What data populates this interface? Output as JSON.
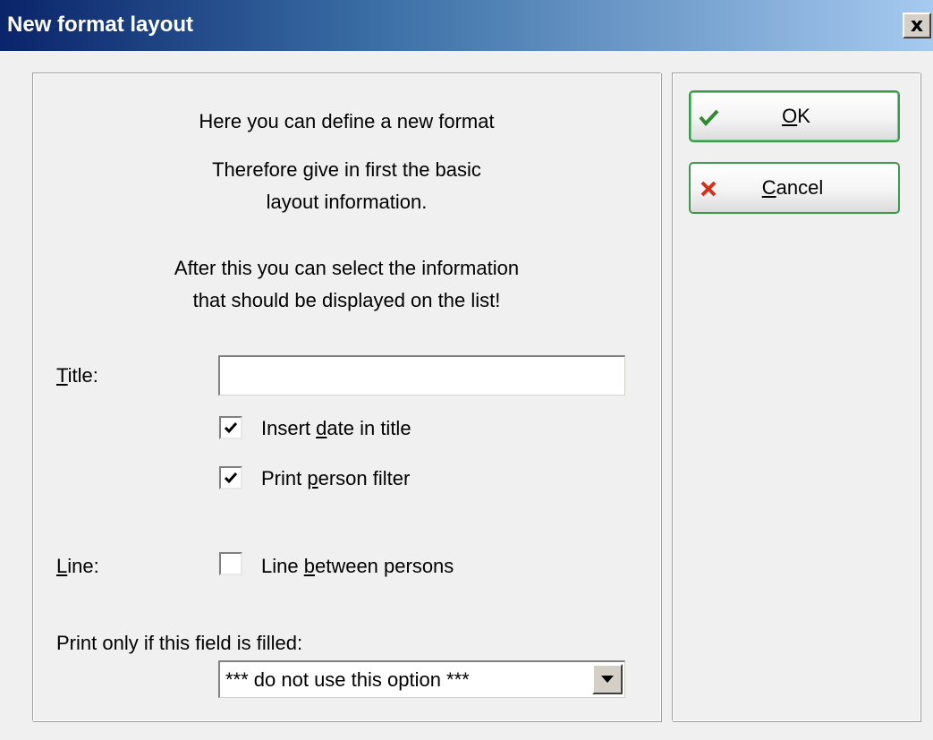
{
  "window": {
    "title": "New format layout",
    "close_label": "x"
  },
  "intro": {
    "line1": "Here you can define a new format",
    "line2a": "Therefore give in first the basic",
    "line2b": "layout information.",
    "line3a": "After this you can select the information",
    "line3b": "that should be displayed on the list!"
  },
  "form": {
    "title_label_u": "T",
    "title_label_rest": "itle:",
    "title_value": "",
    "insert_date": {
      "label_pre": "Insert ",
      "label_u": "d",
      "label_post": "ate in title",
      "checked": true
    },
    "print_filter": {
      "label_pre": "Print ",
      "label_u": "p",
      "label_post": "erson filter",
      "checked": true
    },
    "line_label_u": "L",
    "line_label_rest": "ine:",
    "line_between": {
      "label_pre": "Line ",
      "label_u": "b",
      "label_post": "etween persons",
      "checked": false
    },
    "print_only_label": "Print only if this field is filled:",
    "print_only_value": "*** do not use this option ***"
  },
  "buttons": {
    "ok_u": "O",
    "ok_rest": "K",
    "cancel_u": "C",
    "cancel_rest": "ancel"
  },
  "colors": {
    "ok_check": "#2e8b2e",
    "cancel_x": "#d8301c",
    "button_border": "#3c9a4a"
  }
}
